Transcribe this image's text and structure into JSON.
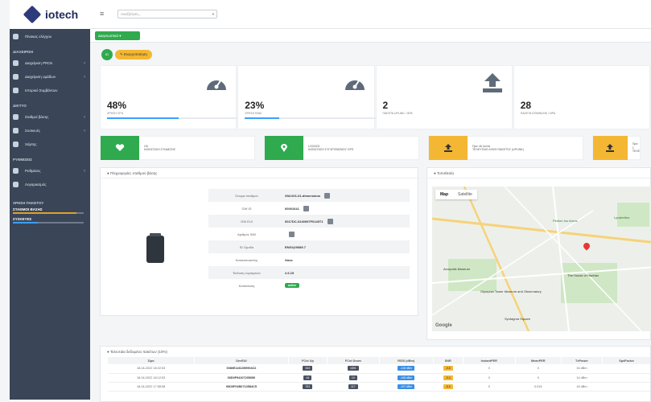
{
  "app": {
    "logo_text": "iotech"
  },
  "topbar": {
    "search_placeholder": "Αναζήτηση..."
  },
  "subbar": {
    "button_label": "Διαγνωστικά"
  },
  "sidebar": {
    "items_top": [
      {
        "label": "Πίνακας ελέγχου",
        "has_arrow": false
      }
    ],
    "section1": "ΔΙΑΧΕΙΡΙΣΗ",
    "section1_items": [
      {
        "label": "Διαχείριση PROs",
        "has_arrow": true
      },
      {
        "label": "Διαχείριση ομάδων",
        "has_arrow": true
      },
      {
        "label": "Ιστορικό Συμβάντων",
        "has_arrow": false
      }
    ],
    "section2": "ΔΙΚΤΥΟ",
    "section2_items": [
      {
        "label": "Σταθμοί βάσης",
        "has_arrow": true
      },
      {
        "label": "Συσκευές",
        "has_arrow": true
      },
      {
        "label": "Χάρτης",
        "has_arrow": false
      }
    ],
    "section3": "ΡΥΘΜΙΣΕΙΣ",
    "section3_items": [
      {
        "label": "Ρυθμίσεις",
        "has_arrow": true
      },
      {
        "label": "Λογαριασμός",
        "has_arrow": false
      }
    ],
    "section4": "ΧΡΗΣΗ ΠΑΚΕΤΟΥ",
    "usage1_label": "ΣΤΑΘΜΟΙ ΒΑΣΗΣ",
    "usage1_fraction": 0.9,
    "usage2_label": "ΣΥΣΚΕΥΕΣ",
    "usage2_fraction": 0.35
  },
  "status": {
    "id_chip": "ID",
    "state_label": "Ενεργοποίηση"
  },
  "stats": [
    {
      "value": "48%",
      "label": "ΧΡΗΣΗ CPU",
      "fraction": 0.48,
      "icon": "gauge-icon"
    },
    {
      "value": "23%",
      "label": "ΧΡΗΣΗ RAM",
      "fraction": 0.23,
      "icon": "gauge-icon"
    },
    {
      "value": "2",
      "label": "ΠΑΚΕΤΑ UPLINK / ΩΡΑ",
      "fraction": 0,
      "icon": "upload-icon"
    },
    {
      "value": "28",
      "label": "ΠΑΚΕΤΑ DOWNLINK / ΩΡΑ",
      "fraction": 0,
      "icon": "download-icon"
    }
  ],
  "tiles": [
    {
      "line1": "OK",
      "line2": "ΚΑΤΑΣΤΑΣΗ ΣΥΝΔΕΣΗΣ",
      "color": "#2faa4e",
      "icon": "heartbeat-icon"
    },
    {
      "line1": "LOCKED",
      "line2": "ΚΑΤΑΣΤΑΣΗ ΣΥΓΧΡΟΝΙΣΜΟΥ GPS",
      "color": "#2faa4e",
      "icon": "location-icon"
    },
    {
      "line1": "Πριν 46 λεπτά",
      "line2": "ΤΕΛΕΥΤΑΙΟ ΛΗΨΗ ΠΑΚΕΤΟΥ (UPLINK)",
      "color": "#f4b733",
      "icon": "upload-icon"
    },
    {
      "line1": "Πριν 1",
      "line2": "ΤΕΛΕ",
      "color": "#f4b733",
      "icon": "download-icon"
    }
  ],
  "info_panel": {
    "title": "Πληροφορίες σταθμού βάσης",
    "rows": [
      {
        "key": "Όνομα σταθμού",
        "value": "GW-001-01-dimensions",
        "copy": true
      },
      {
        "key": "GW ID",
        "value": "00001641",
        "copy": true
      },
      {
        "key": "GW EUI",
        "value": "0017DC-0240097F0140T1",
        "copy": true
      },
      {
        "key": "Αριθμός SIM",
        "value": "",
        "copy": true
      },
      {
        "key": "ID Ομαδα",
        "value": "ENGI@9089.7",
        "copy": false
      },
      {
        "key": "Κατασκευαστής",
        "value": "Gaxx",
        "copy": false
      },
      {
        "key": "Έκδοση λογισμικού",
        "value": "2.6.15",
        "copy": false
      },
      {
        "key": "Κατάσταση",
        "value": "active",
        "copy": false,
        "badge": true
      }
    ]
  },
  "map_panel": {
    "title": "Τοποθεσία",
    "tabs": [
      "Map",
      "Satellite"
    ],
    "active_tab": "Map",
    "labels": [
      "Pedion tou Areos",
      "The House of Hadrian",
      "Acropolis Museum",
      "Olympian Tower Museum and Observatory",
      "Lycabettus",
      "Syntagma Square"
    ],
    "google": "Google"
  },
  "table_panel": {
    "title": "Τελευταία δεδομένα πακέτων (10%)",
    "columns": [
      "Ώρα",
      "DevEUI",
      "FCnt Up",
      "FCnt Down",
      "RSSI (dBm)",
      "SNR",
      "InstantPER",
      "MeanPER",
      "TxPower",
      "SpdFactor"
    ],
    "rows": [
      [
        "18-04-2022 18:22:53",
        "0080E1461059904C2",
        "543",
        "1891",
        "-118 dBm",
        "-9.8",
        "0",
        "0",
        "16 dBm",
        ""
      ],
      [
        "18-04-2022 18:12:53",
        "00D0F94107205050",
        "44",
        "19",
        "-108 dBm",
        "-9.4",
        "0",
        "0",
        "14 dBm",
        ""
      ],
      [
        "18-04-2022 17:58:58",
        "00D0F01B0713584C5",
        "761",
        "117",
        "-107 dBm",
        "-8.6",
        "0",
        "0.015",
        "16 dBm",
        ""
      ]
    ]
  },
  "colors": {
    "sidebar_bg": "#3a4557",
    "accent_green": "#2faa4e",
    "accent_yellow": "#f4b733",
    "accent_blue": "#3aa0ff"
  }
}
